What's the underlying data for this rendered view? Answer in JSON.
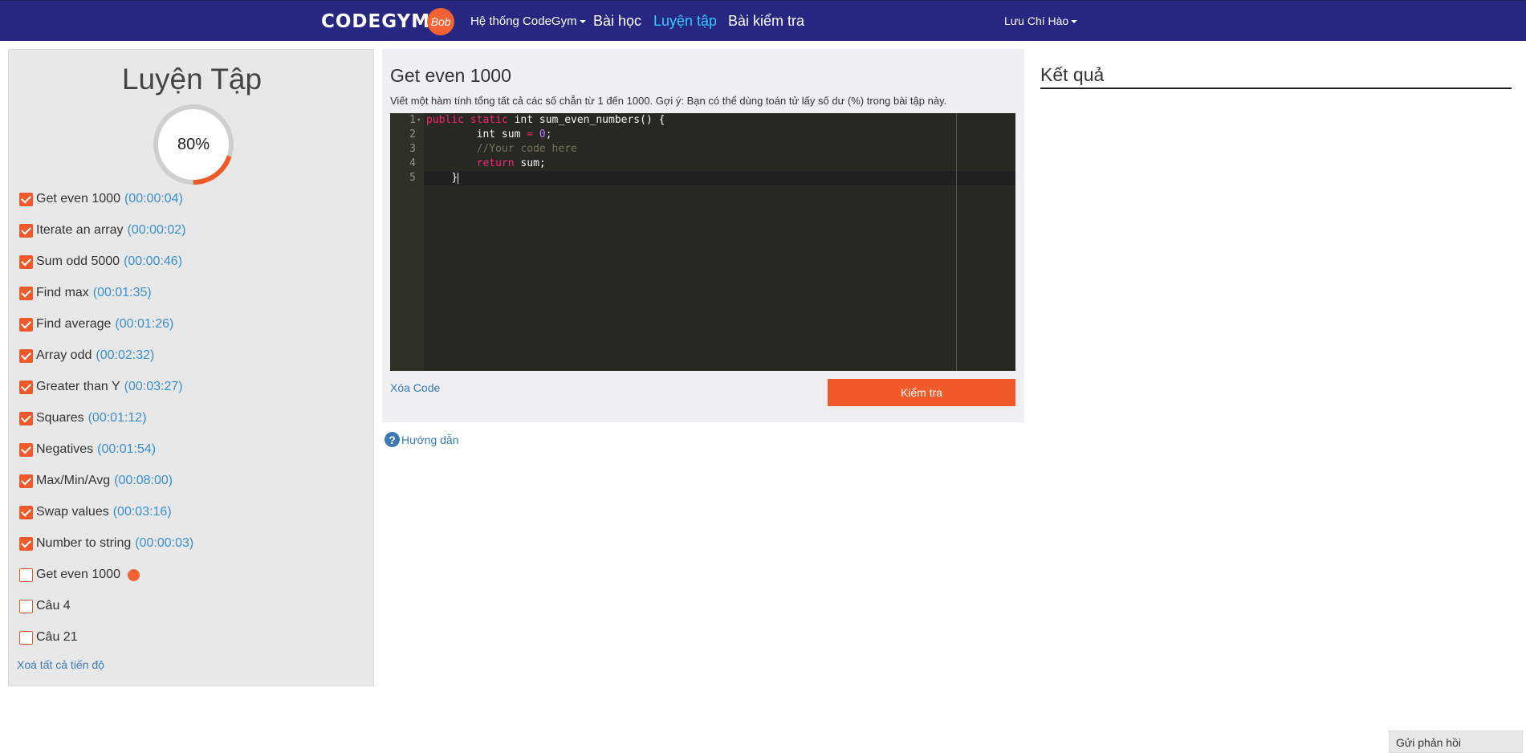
{
  "navbar": {
    "logo_text": "CODEGYM",
    "logo_badge": "Bob",
    "system_label": "Hệ thống CodeGym",
    "lessons_label": "Bài học",
    "practice_label": "Luyện tập",
    "tests_label": "Bài kiểm tra",
    "user_name": "Lưu Chí Hào",
    "active_color": "#33ccff",
    "bg_color": "#272782"
  },
  "sidebar": {
    "title": "Luyện Tập",
    "progress_label": "80%",
    "progress_value": 0.8,
    "tasks": [
      {
        "name": "Get even 1000",
        "time": "(00:00:04)",
        "done": true
      },
      {
        "name": "Iterate an array",
        "time": "(00:00:02)",
        "done": true
      },
      {
        "name": "Sum odd 5000",
        "time": "(00:00:46)",
        "done": true
      },
      {
        "name": "Find max",
        "time": "(00:01:35)",
        "done": true
      },
      {
        "name": "Find average",
        "time": "(00:01:26)",
        "done": true
      },
      {
        "name": "Array odd",
        "time": "(00:02:32)",
        "done": true
      },
      {
        "name": "Greater than Y",
        "time": "(00:03:27)",
        "done": true
      },
      {
        "name": "Squares",
        "time": "(00:01:12)",
        "done": true
      },
      {
        "name": "Negatives",
        "time": "(00:01:54)",
        "done": true
      },
      {
        "name": "Max/Min/Avg",
        "time": "(00:08:00)",
        "done": true
      },
      {
        "name": "Swap values",
        "time": "(00:03:16)",
        "done": true
      },
      {
        "name": "Number to string",
        "time": "(00:00:03)",
        "done": true
      },
      {
        "name": "Get even 1000",
        "time": "",
        "done": false,
        "current": true
      },
      {
        "name": "Câu 4",
        "time": "",
        "done": false
      },
      {
        "name": "Câu 21",
        "time": "",
        "done": false
      }
    ],
    "clear_all_label": "Xoá tất cả tiến độ"
  },
  "exercise": {
    "title": "Get even 1000",
    "description": "Viết một hàm tính tổng tất cả các số chẵn từ 1 đến 1000. Gợi ý: Bạn có thể dùng toán tử lấy số dư (%) trong bài tập này.",
    "line_numbers": [
      "1",
      "2",
      "3",
      "4",
      "5"
    ],
    "code": {
      "l1_kw1": "public",
      "l1_kw2": "static",
      "l1_rest": "int sum_even_numbers() {",
      "l2_a": "int sum ",
      "l2_op": "=",
      "l2_num": "0",
      "l2_end": ";",
      "l3_comment": "//Your code here",
      "l4_kw": "return",
      "l4_rest": "sum;",
      "l5": "}"
    },
    "clear_code_label": "Xóa Code",
    "check_label": "Kiểm tra",
    "help_label": "Hướng dẫn"
  },
  "result": {
    "title": "Kết quả"
  },
  "feedback": {
    "label": "Gửi phản hồi"
  }
}
